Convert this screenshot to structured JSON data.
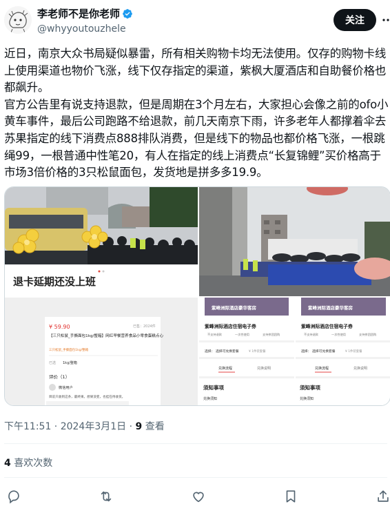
{
  "author": {
    "display_name": "李老师不是你老师",
    "handle": "@whyyoutouzhele",
    "follow_label": "关注"
  },
  "tweet": {
    "text": "近日，南京大众书局疑似暴雷，所有相关购物卡均无法使用。仅存的购物卡线上使用渠道也物价飞涨，线下仅存指定的渠道，紫枫大厦酒店和自助餐价格也都飙升。\n官方公告里有说支持退款，但是周期在3个月左右，大家担心会像之前的ofo小黄车事件，最后公司跑路不给退款，前几天南京下雨，许多老年人都撑着伞去苏果指定的线下消费点888排队消费，但是线下的物品也都价格飞涨，一根跳绳99，一根普通中性笔20，有人在指定的线上消费点“长复锦鲤”买价格高于市场3倍价格的3只松鼠面包，发货地是拼多多19.9。"
  },
  "media": {
    "image1_caption": "退卡延期还没上班",
    "image3": {
      "price": "¥ 59.90",
      "stock": "已售：2024件",
      "title": "【三只松鼠_手撕面包1kg/整箱】网红早餐营养食品小零食蛋糕点心",
      "tag": "三只松鼠_手撕面包1kg/整箱",
      "spec_label": "已选",
      "spec_value": "1kg/整箱",
      "reviews_label": "评价（1）",
      "reviewer": "微信用户",
      "review_text": "目前只收到这条，最终果。想果没变，也挂在待收货。"
    },
    "image4": {
      "header": "紫峰洲际酒店豪华客房",
      "title": "紫峰洲际酒店住宿电子券",
      "tag1": "不支持退款",
      "tag2": "一次性使用",
      "tag3": "支持拼团团购",
      "option_label": "选择：",
      "option_value": "选择可兑换套餐",
      "option_sub": "¥ 1件装套餐",
      "tab1": "兑换流程",
      "tab2": "兑换说明",
      "notice_title": "须知事项",
      "notice_sub": "兑换须知"
    },
    "image5": {
      "header": "紫峰洲际酒店豪华客房",
      "title": "紫峰洲际酒店住宿电子券",
      "tag1": "不支持退款",
      "tag2": "一次性使用",
      "tag3": "支持拼团团购",
      "option_label": "选择：",
      "option_value": "选择可兑换套餐",
      "option_sub": "¥ 1件装套餐",
      "tab1": "兑换流程",
      "tab2": "兑换说明",
      "notice_title": "须知事项",
      "notice_sub": "兑换须知"
    }
  },
  "meta": {
    "timestamp": "下午11:51 · 2024年3月1日 · ",
    "views_count": "9",
    "views_label": " 查看"
  },
  "engagement": {
    "likes_count": "4",
    "likes_label": " 喜欢次数"
  },
  "icons": {
    "verified": "verified-badge-icon",
    "reply": "reply-icon",
    "retweet": "retweet-icon",
    "like": "heart-icon",
    "bookmark": "bookmark-icon",
    "share": "share-icon"
  },
  "colors": {
    "text": "#0f1419",
    "secondary": "#536471",
    "verified": "#1d9bf0",
    "border": "#eff3f4"
  }
}
